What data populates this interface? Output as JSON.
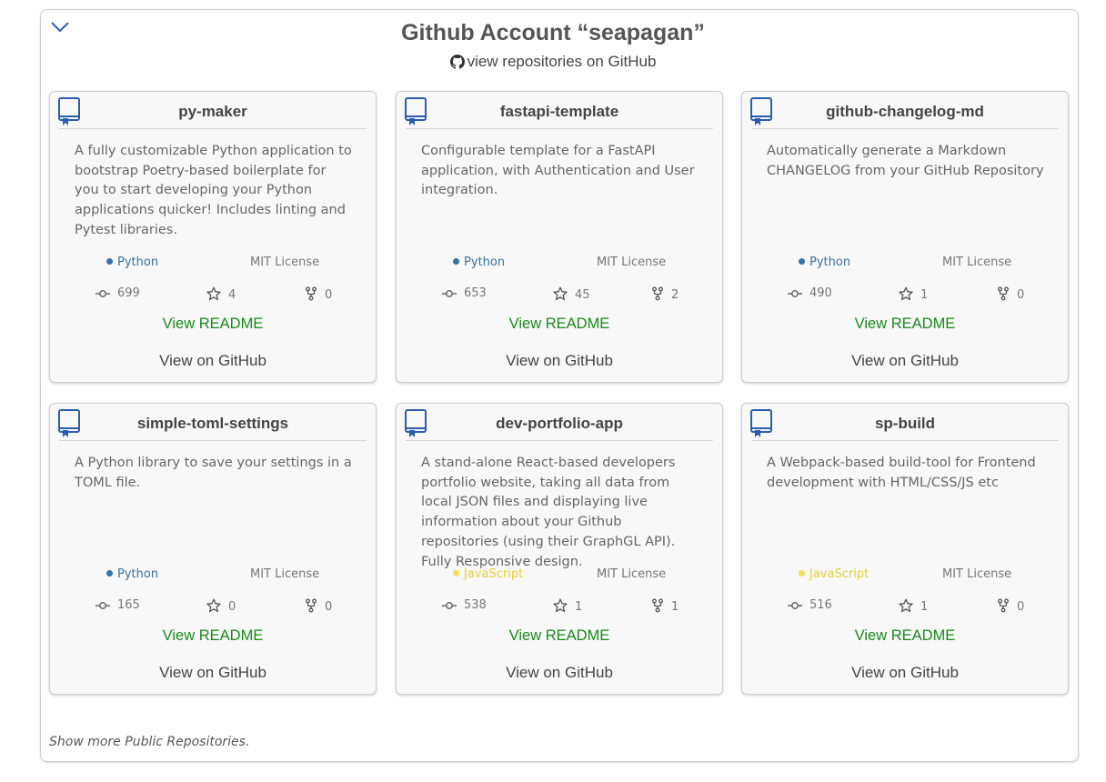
{
  "header": {
    "title": "Github Account “seapagan”",
    "link_label": "view repositories on GitHub"
  },
  "labels": {
    "view_readme": "View README",
    "view_github": "View on GitHub"
  },
  "colors": {
    "accent_blue": "#2a5db0",
    "readme_green": "#1a8a1a",
    "python": "#3572A5",
    "javascript": "#f1e05a"
  },
  "repos": [
    {
      "name": "py-maker",
      "description": "A fully customizable Python application to bootstrap Poetry-based boilerplate for you to start developing your Python applications quicker! Includes linting and Pytest libraries.",
      "language": "Python",
      "language_color": "#3572A5",
      "license": "MIT License",
      "commits": "699",
      "stars": "4",
      "forks": "0"
    },
    {
      "name": "fastapi-template",
      "description": "Configurable template for a FastAPI application, with Authentication and User integration.",
      "language": "Python",
      "language_color": "#3572A5",
      "license": "MIT License",
      "commits": "653",
      "stars": "45",
      "forks": "2"
    },
    {
      "name": "github-changelog-md",
      "description": "Automatically generate a Markdown CHANGELOG from your GitHub Repository",
      "language": "Python",
      "language_color": "#3572A5",
      "license": "MIT License",
      "commits": "490",
      "stars": "1",
      "forks": "0"
    },
    {
      "name": "simple-toml-settings",
      "description": "A Python library to save your settings in a TOML file.",
      "language": "Python",
      "language_color": "#3572A5",
      "license": "MIT License",
      "commits": "165",
      "stars": "0",
      "forks": "0"
    },
    {
      "name": "dev-portfolio-app",
      "description": "A stand-alone React-based developers portfolio website, taking all data from local JSON files and displaying live information about your Github repositories (using their GraphGL API). Fully Responsive design.",
      "language": "JavaScript",
      "language_color": "#f1e05a",
      "license": "MIT License",
      "commits": "538",
      "stars": "1",
      "forks": "1"
    },
    {
      "name": "sp-build",
      "description": "A Webpack-based build-tool for Frontend development with HTML/CSS/JS etc",
      "language": "JavaScript",
      "language_color": "#f1e05a",
      "license": "MIT License",
      "commits": "516",
      "stars": "1",
      "forks": "0"
    }
  ],
  "footer": {
    "show_more": "Show more Public Repositories."
  }
}
